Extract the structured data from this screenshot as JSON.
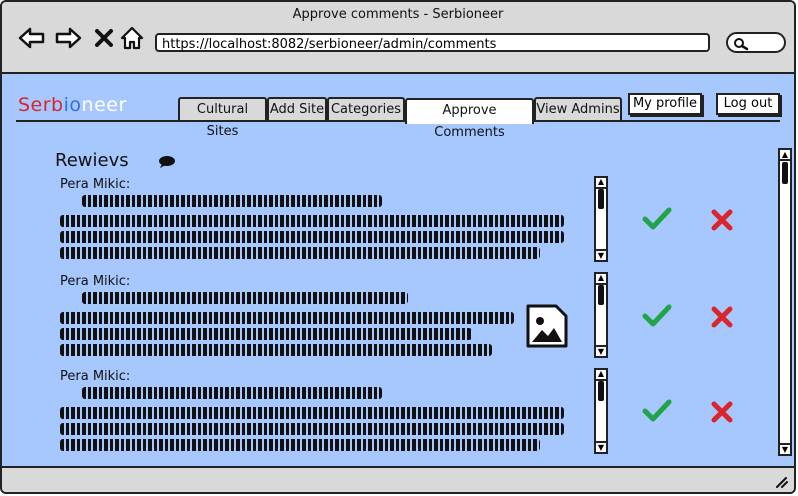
{
  "window": {
    "title": "Approve comments - Serbioneer"
  },
  "browser": {
    "url": "https://localhost:8082/serbioneer/admin/comments"
  },
  "logo": {
    "part1": "Serb",
    "part2": "io",
    "part3": "neer"
  },
  "tabs": [
    {
      "label": "Cultural Sites"
    },
    {
      "label": "Add Site"
    },
    {
      "label": "Categories"
    },
    {
      "label": "Approve Comments"
    },
    {
      "label": "View Admins"
    }
  ],
  "header": {
    "profile_label": "My profile",
    "logout_label": "Log out"
  },
  "section": {
    "title": "Rewievs"
  },
  "reviews": [
    {
      "author": "Pera Mikic:"
    },
    {
      "author": "Pera Mikic:"
    },
    {
      "author": "Pera Mikic:"
    }
  ],
  "colors": {
    "accept": "#22a34a",
    "reject": "#d9262a",
    "content_bg": "#a6c8ff"
  }
}
